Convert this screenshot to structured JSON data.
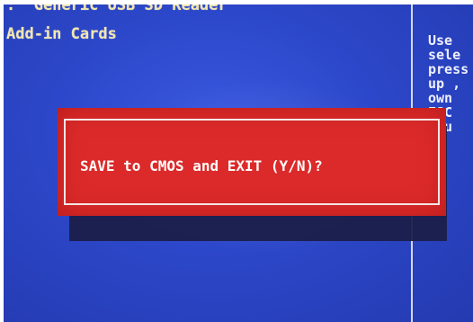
{
  "screen": {
    "bios_lines": [
      ":  Generic USB SD Reader",
      "Add-in Cards"
    ],
    "help_lines": [
      "Use",
      "sele",
      "press",
      "up ,",
      "own",
      "ESC",
      "enu"
    ]
  },
  "dialog": {
    "message": "SAVE to CMOS and EXIT (Y/N)?"
  },
  "colors": {
    "background": "#2c47c9",
    "bios_text": "#f1e6b0",
    "dialog_red": "#dc2a2a",
    "dialog_text": "#fffdfa"
  }
}
